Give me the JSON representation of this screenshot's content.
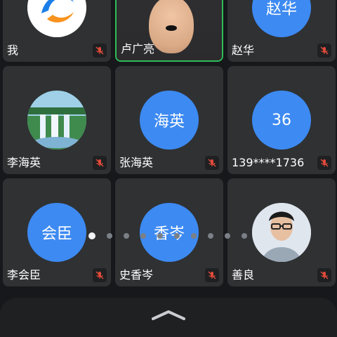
{
  "participants": [
    {
      "name": "我"
    },
    {
      "name": "卢广亮"
    },
    {
      "name": "赵华",
      "avatar_text": "赵华"
    },
    {
      "name": "李海英"
    },
    {
      "name": "张海英",
      "avatar_text": "海英"
    },
    {
      "name": "139****1736",
      "avatar_text": "36"
    },
    {
      "name": "李会臣",
      "avatar_text": "会臣"
    },
    {
      "name": "史香岑",
      "avatar_text": "香岑"
    },
    {
      "name": "善良"
    }
  ],
  "colors": {
    "avatar_blue": "#3d8af2",
    "active_border": "#2fbd57",
    "tile_bg": "#2f3133",
    "background": "#17181b"
  },
  "pager": {
    "pages": 10,
    "current": 1
  },
  "icons": [
    "muted-mic-icon",
    "expand-up-icon"
  ]
}
